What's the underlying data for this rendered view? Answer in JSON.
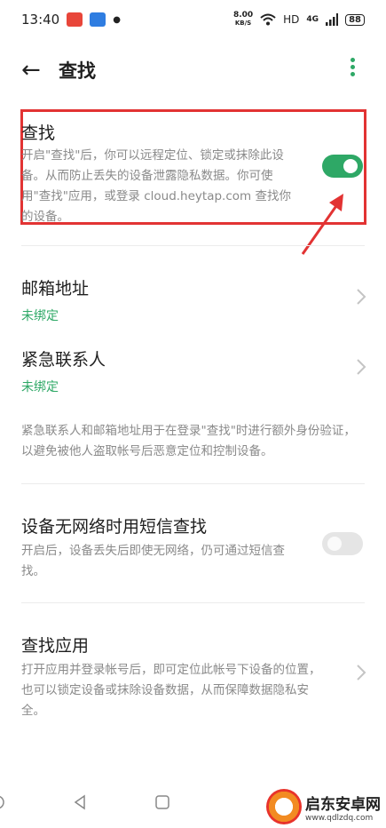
{
  "status_bar": {
    "time": "13:40",
    "speed_value": "8.00",
    "speed_unit": "KB/S",
    "hd": "HD",
    "network": "4G",
    "battery": "88"
  },
  "header": {
    "title": "查找"
  },
  "find_section": {
    "title": "查找",
    "description": "开启\"查找\"后，你可以远程定位、锁定或抹除此设备。从而防止丢失的设备泄露隐私数据。你可使用\"查找\"应用，或登录 cloud.heytap.com 查找你的设备。",
    "toggle_on": true
  },
  "email_section": {
    "title": "邮箱地址",
    "status": "未绑定"
  },
  "contact_section": {
    "title": "紧急联系人",
    "status": "未绑定"
  },
  "contact_note": "紧急联系人和邮箱地址用于在登录\"查找\"时进行额外身份验证，以避免被他人盗取帐号后恶意定位和控制设备。",
  "sms_section": {
    "title": "设备无网络时用短信查找",
    "description": "开启后，设备丢失后即使无网络，仍可通过短信查找。",
    "toggle_on": false
  },
  "app_section": {
    "title": "查找应用",
    "description": "打开应用并登录帐号后，即可定位此帐号下设备的位置，也可以锁定设备或抹除设备数据，从而保障数据隐私安全。"
  },
  "watermark": {
    "name": "启东安卓网",
    "url": "www.qdlzdq.com"
  },
  "colors": {
    "accent": "#2ea866",
    "highlight": "#e23333"
  }
}
